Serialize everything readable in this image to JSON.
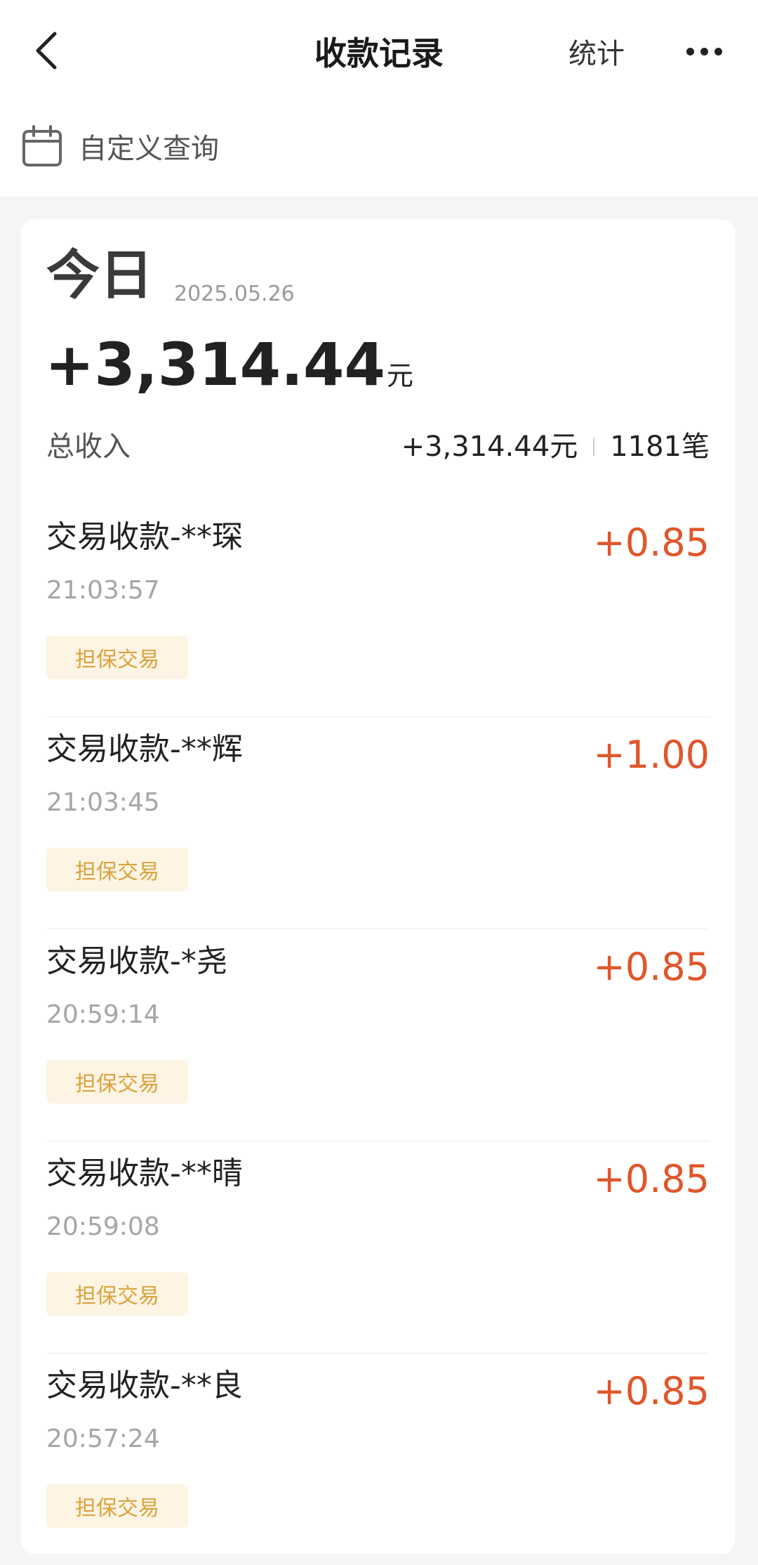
{
  "header": {
    "title": "收款记录",
    "stats_label": "统计",
    "back_icon": "chevron-left-icon",
    "more_icon": "more-horizontal-icon"
  },
  "filter": {
    "label": "自定义查询",
    "icon": "calendar-icon"
  },
  "day": {
    "title": "今日",
    "date": "2025.05.26",
    "total_amount": "+3,314.44",
    "total_unit": "元",
    "summary_label": "总收入",
    "summary_amount": "+3,314.44元",
    "summary_count": "1181笔"
  },
  "transactions": [
    {
      "name": "交易收款-**琛",
      "time": "21:03:57",
      "tag": "担保交易",
      "amount": "+0.85"
    },
    {
      "name": "交易收款-**辉",
      "time": "21:03:45",
      "tag": "担保交易",
      "amount": "+1.00"
    },
    {
      "name": "交易收款-*尧",
      "time": "20:59:14",
      "tag": "担保交易",
      "amount": "+0.85"
    },
    {
      "name": "交易收款-**晴",
      "time": "20:59:08",
      "tag": "担保交易",
      "amount": "+0.85"
    },
    {
      "name": "交易收款-**良",
      "time": "20:57:24",
      "tag": "担保交易",
      "amount": "+0.85"
    }
  ],
  "colors": {
    "amount": "#e0562b",
    "tag_bg": "#fdf4e3",
    "tag_text": "#d9a23e"
  }
}
